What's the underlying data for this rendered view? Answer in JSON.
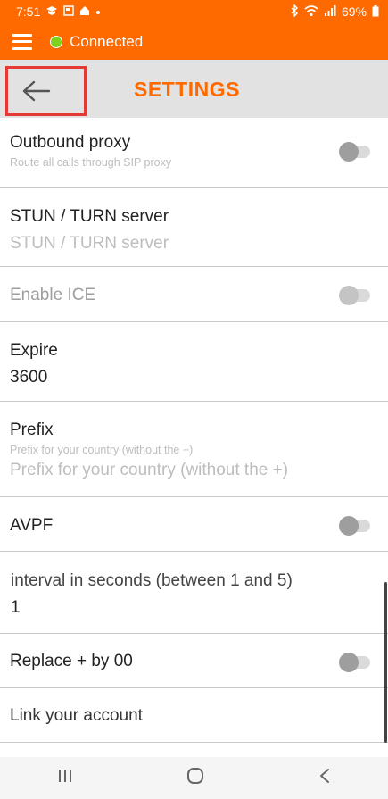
{
  "status_bar": {
    "time": "7:51",
    "battery": "69%",
    "left_icons": [
      "notification-icon",
      "image-icon",
      "home-icon",
      "dot-icon"
    ],
    "right_icons": [
      "bluetooth-icon",
      "wifi-icon",
      "signal-icon",
      "battery-icon"
    ]
  },
  "app_bar": {
    "connection_status": "Connected",
    "status_color": "#7ed321",
    "accent": "#ff6a00"
  },
  "title_bar": {
    "title": "SETTINGS"
  },
  "settings": {
    "outbound_proxy": {
      "label": "Outbound proxy",
      "sub": "Route all calls through SIP proxy",
      "enabled": false
    },
    "stun_turn": {
      "label": "STUN / TURN server",
      "placeholder": "STUN / TURN server"
    },
    "enable_ice": {
      "label": "Enable ICE",
      "enabled": false
    },
    "expire": {
      "label": "Expire",
      "value": "3600"
    },
    "prefix": {
      "label": "Prefix",
      "sub": "Prefix for your country (without the +)",
      "placeholder": "Prefix for your country (without the +)"
    },
    "avpf": {
      "label": "AVPF",
      "enabled": false
    },
    "interval": {
      "label": "interval in seconds (between 1 and 5)",
      "value": "1"
    },
    "replace_plus": {
      "label": "Replace + by 00",
      "enabled": false
    },
    "link_account": {
      "label": "Link your account"
    }
  },
  "nav_bar": {
    "buttons": [
      "recents-icon",
      "home-icon",
      "back-icon"
    ]
  }
}
